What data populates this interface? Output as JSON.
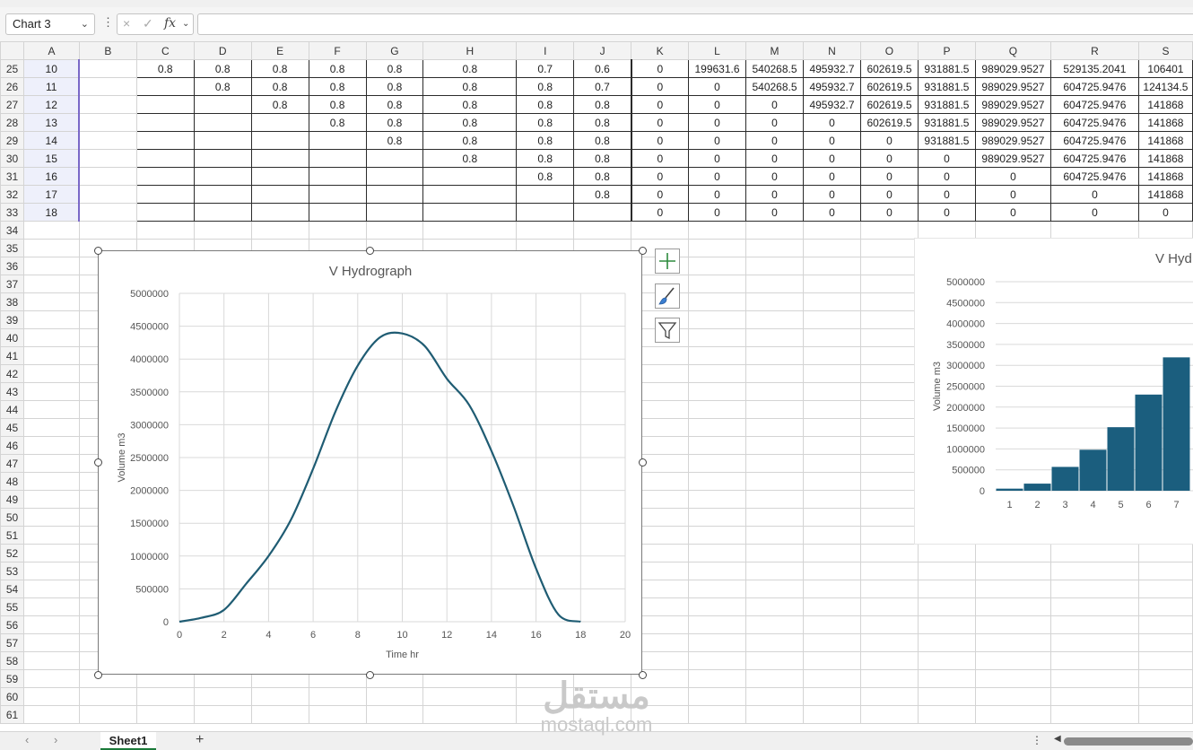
{
  "name_box": "Chart 3",
  "formula_icons": [
    "×",
    "✓",
    "fx"
  ],
  "columns": [
    "A",
    "B",
    "C",
    "D",
    "E",
    "F",
    "G",
    "H",
    "I",
    "J",
    "K",
    "L",
    "M",
    "N",
    "O",
    "P",
    "Q",
    "R",
    "S"
  ],
  "col_widths": [],
  "rows": [
    {
      "n": "25",
      "cells": [
        "10",
        "",
        "0.8",
        "0.8",
        "0.8",
        "0.8",
        "0.8",
        "0.8",
        "0.7",
        "0.6",
        "0",
        "199631.6",
        "540268.5",
        "495932.7",
        "602619.5",
        "931881.5",
        "989029.9527",
        "529135.2041",
        "106401"
      ]
    },
    {
      "n": "26",
      "cells": [
        "11",
        "",
        "",
        "0.8",
        "0.8",
        "0.8",
        "0.8",
        "0.8",
        "0.8",
        "0.7",
        "0",
        "0",
        "540268.5",
        "495932.7",
        "602619.5",
        "931881.5",
        "989029.9527",
        "604725.9476",
        "124134.5"
      ]
    },
    {
      "n": "27",
      "cells": [
        "12",
        "",
        "",
        "",
        "0.8",
        "0.8",
        "0.8",
        "0.8",
        "0.8",
        "0.8",
        "0",
        "0",
        "0",
        "495932.7",
        "602619.5",
        "931881.5",
        "989029.9527",
        "604725.9476",
        "141868"
      ]
    },
    {
      "n": "28",
      "cells": [
        "13",
        "",
        "",
        "",
        "",
        "0.8",
        "0.8",
        "0.8",
        "0.8",
        "0.8",
        "0",
        "0",
        "0",
        "0",
        "602619.5",
        "931881.5",
        "989029.9527",
        "604725.9476",
        "141868"
      ]
    },
    {
      "n": "29",
      "cells": [
        "14",
        "",
        "",
        "",
        "",
        "",
        "0.8",
        "0.8",
        "0.8",
        "0.8",
        "0",
        "0",
        "0",
        "0",
        "0",
        "931881.5",
        "989029.9527",
        "604725.9476",
        "141868"
      ]
    },
    {
      "n": "30",
      "cells": [
        "15",
        "",
        "",
        "",
        "",
        "",
        "",
        "0.8",
        "0.8",
        "0.8",
        "0",
        "0",
        "0",
        "0",
        "0",
        "0",
        "989029.9527",
        "604725.9476",
        "141868"
      ]
    },
    {
      "n": "31",
      "cells": [
        "16",
        "",
        "",
        "",
        "",
        "",
        "",
        "",
        "0.8",
        "0.8",
        "0",
        "0",
        "0",
        "0",
        "0",
        "0",
        "0",
        "604725.9476",
        "141868"
      ]
    },
    {
      "n": "32",
      "cells": [
        "17",
        "",
        "",
        "",
        "",
        "",
        "",
        "",
        "",
        "0.8",
        "0",
        "0",
        "0",
        "0",
        "0",
        "0",
        "0",
        "0",
        "141868"
      ]
    },
    {
      "n": "33",
      "cells": [
        "18",
        "",
        "",
        "",
        "",
        "",
        "",
        "",
        "",
        "",
        "0",
        "0",
        "0",
        "0",
        "0",
        "0",
        "0",
        "0",
        "0"
      ]
    }
  ],
  "empty_rows": [
    "34",
    "35",
    "36",
    "37",
    "38",
    "39",
    "40",
    "41",
    "42",
    "43",
    "44",
    "45",
    "46",
    "47",
    "48",
    "49",
    "50",
    "51",
    "52",
    "53",
    "54",
    "55",
    "56",
    "57",
    "58",
    "59",
    "60",
    "61"
  ],
  "chart_data": [
    {
      "type": "line",
      "title": "V Hydrograph",
      "xlabel": "Time hr",
      "ylabel": "Volume m3",
      "xlim": [
        0,
        20
      ],
      "ylim": [
        0,
        5000000
      ],
      "x_ticks": [
        "0",
        "2",
        "4",
        "6",
        "8",
        "10",
        "12",
        "14",
        "16",
        "18",
        "20"
      ],
      "y_ticks": [
        "0",
        "500000",
        "1000000",
        "1500000",
        "2000000",
        "2500000",
        "3000000",
        "3500000",
        "4000000",
        "4500000",
        "5000000"
      ],
      "grid": true,
      "color": "#1f5c73",
      "x": [
        0,
        1,
        2,
        3,
        4,
        5,
        6,
        7,
        8,
        9,
        10,
        11,
        12,
        13,
        14,
        15,
        16,
        17,
        18
      ],
      "y": [
        0,
        60000,
        180000,
        580000,
        1000000,
        1550000,
        2330000,
        3200000,
        3900000,
        4330000,
        4390000,
        4200000,
        3700000,
        3300000,
        2600000,
        1750000,
        810000,
        110000,
        0
      ]
    },
    {
      "type": "bar",
      "title": "V Hyd",
      "ylabel": "Volume m3",
      "ylim": [
        0,
        5000000
      ],
      "categories": [
        "1",
        "2",
        "3",
        "4",
        "5",
        "6",
        "7"
      ],
      "y_ticks": [
        "0",
        "500000",
        "1000000",
        "1500000",
        "2000000",
        "2500000",
        "3000000",
        "3500000",
        "4000000",
        "4500000",
        "5000000"
      ],
      "color": "#1b5e7e",
      "values": [
        50000,
        170000,
        570000,
        980000,
        1520000,
        2300000,
        3190000
      ]
    }
  ],
  "tabs": {
    "active": "Sheet1",
    "add": "+"
  },
  "watermark": {
    "arabic": "مستقل",
    "latin": "mostaql.com"
  }
}
